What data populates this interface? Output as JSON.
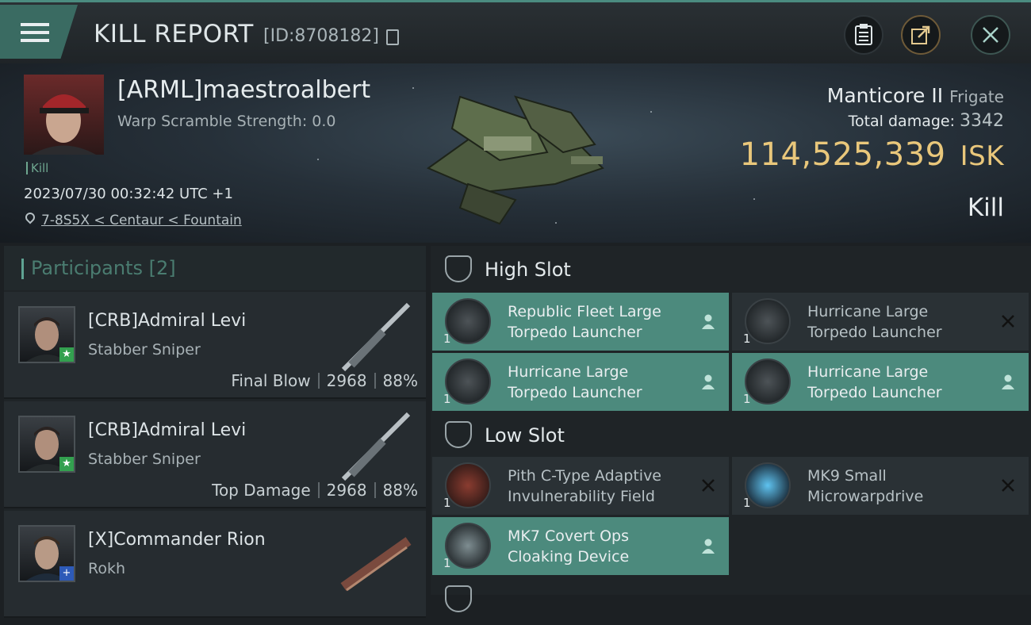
{
  "header": {
    "title": "KILL REPORT",
    "report_id": "[ID:8708182]"
  },
  "victim": {
    "name": "[ARML]maestroalbert",
    "warp_scramble": "Warp Scramble Strength: 0.0",
    "tag": "Kill",
    "timestamp": "2023/07/30 00:32:42 UTC +1",
    "location": "7-8S5X < Centaur < Fountain",
    "ship": "Manticore II",
    "ship_class": "Frigate",
    "total_damage_label": "Total damage:",
    "total_damage": "3342",
    "isk_value": "114,525,339",
    "isk_unit": "ISK",
    "result": "Kill"
  },
  "participants": {
    "label": "Participants [2]",
    "list": [
      {
        "name": "[CRB]Admiral Levi",
        "ship": "Stabber Sniper",
        "role": "Final Blow",
        "damage": "2968",
        "percent": "88%",
        "badge": "★"
      },
      {
        "name": "[CRB]Admiral Levi",
        "ship": "Stabber Sniper",
        "role": "Top Damage",
        "damage": "2968",
        "percent": "88%",
        "badge": "★"
      },
      {
        "name": "[X]Commander Rion",
        "ship": "Rokh",
        "role": "",
        "damage": "",
        "percent": "",
        "badge": "+"
      }
    ]
  },
  "slots": {
    "high_label": "High Slot",
    "low_label": "Low Slot",
    "high": [
      {
        "line1": "Republic Fleet Large",
        "line2": "Torpedo Launcher",
        "qty": "1",
        "state": "dropped"
      },
      {
        "line1": "Hurricane Large",
        "line2": "Torpedo Launcher",
        "qty": "1",
        "state": "destroyed"
      },
      {
        "line1": "Hurricane Large",
        "line2": "Torpedo Launcher",
        "qty": "1",
        "state": "dropped"
      },
      {
        "line1": "Hurricane Large",
        "line2": "Torpedo Launcher",
        "qty": "1",
        "state": "dropped"
      }
    ],
    "low": [
      {
        "line1": "Pith C-Type Adaptive",
        "line2": "Invulnerability Field",
        "qty": "1",
        "state": "destroyed"
      },
      {
        "line1": "MK9 Small",
        "line2": "Microwarpdrive",
        "qty": "1",
        "state": "destroyed"
      },
      {
        "line1": "MK7 Covert Ops",
        "line2": "Cloaking Device",
        "qty": "1",
        "state": "dropped"
      }
    ]
  },
  "colors": {
    "accent": "#4c8a7d",
    "isk": "#e9c77b"
  }
}
